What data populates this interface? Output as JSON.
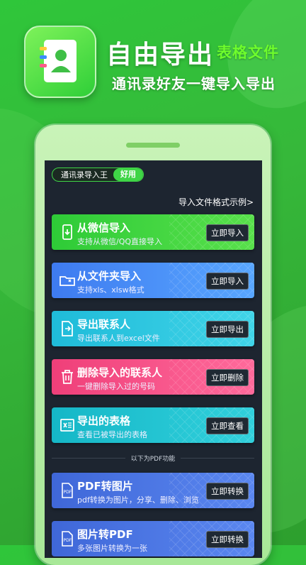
{
  "promo": {
    "title": "自由导出",
    "badge": "表格文件",
    "subtitle": "通讯录好友一键导入导出"
  },
  "header": {
    "app_name": "通讯录导入王",
    "pill": "好用",
    "format_link": "导入文件格式示例>"
  },
  "cards": [
    {
      "title": "从微信导入",
      "desc": "支持从微信/QQ直接导入",
      "button": "立即导入",
      "icon": "phone-import-icon",
      "color": "#2ecb37"
    },
    {
      "title": "从文件夹导入",
      "desc": "支持xls、xlsw格式",
      "button": "立即导入",
      "icon": "folder-icon",
      "color": "#3e7bf0"
    },
    {
      "title": "导出联系人",
      "desc": "导出联系人到excel文件",
      "button": "立即导出",
      "icon": "export-doc-icon",
      "color": "#1fbbd9"
    },
    {
      "title": "删除导入的联系人",
      "desc": "一键删除导入过的号码",
      "button": "立即删除",
      "icon": "trash-icon",
      "color": "#ef3f79"
    },
    {
      "title": "导出的表格",
      "desc": "查看已被导出的表格",
      "button": "立即查看",
      "icon": "excel-icon",
      "color": "#15b7c7"
    }
  ],
  "pdf_section": {
    "label": "以下为PDF功能",
    "cards": [
      {
        "title": "PDF转图片",
        "desc": "pdf转换为图片，分享、删除、浏览",
        "button": "立即转换",
        "icon": "pdf-icon",
        "color": "#3f67d8"
      },
      {
        "title": "图片转PDF",
        "desc": "多张图片转换为一张",
        "button": "立即转换",
        "icon": "image-pdf-icon",
        "color": "#3f67d8"
      }
    ]
  }
}
